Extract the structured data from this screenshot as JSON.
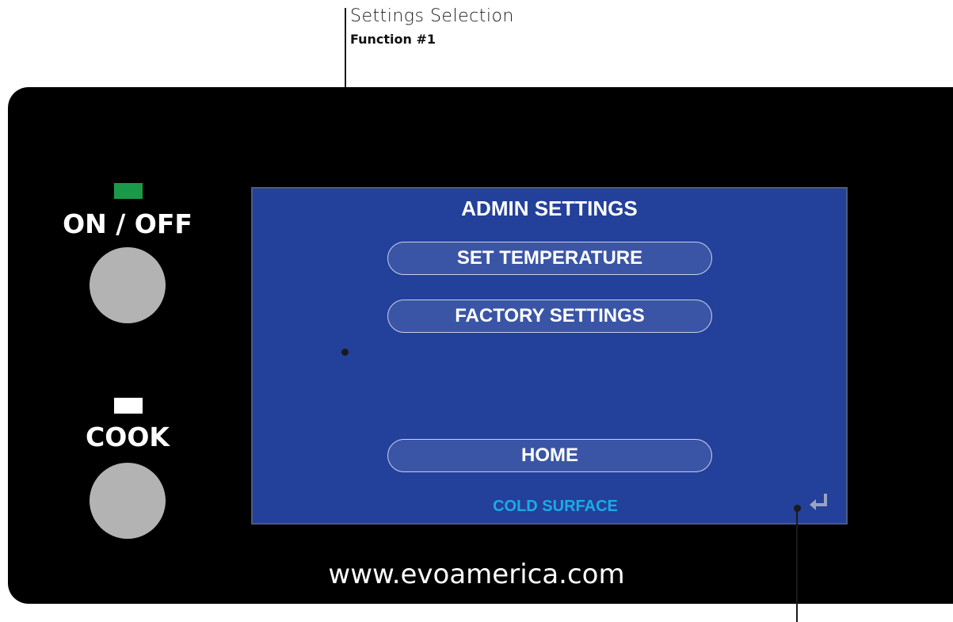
{
  "callout": {
    "title": "Settings Selection",
    "subtitle": "Function #1"
  },
  "controls": {
    "power_label": "ON / OFF",
    "power_led_color": "#1a9a48",
    "cook_label": "COOK",
    "cook_led_color": "#ffffff"
  },
  "screen": {
    "title": "ADMIN SETTINGS",
    "buttons": [
      "SET TEMPERATURE",
      "FACTORY SETTINGS"
    ],
    "home_label": "HOME",
    "status": "COLD SURFACE",
    "return_icon": "return-arrow-icon",
    "bg_color": "#23409a",
    "status_color": "#1fa9e6"
  },
  "footer": {
    "url": "www.evoamerica.com"
  }
}
